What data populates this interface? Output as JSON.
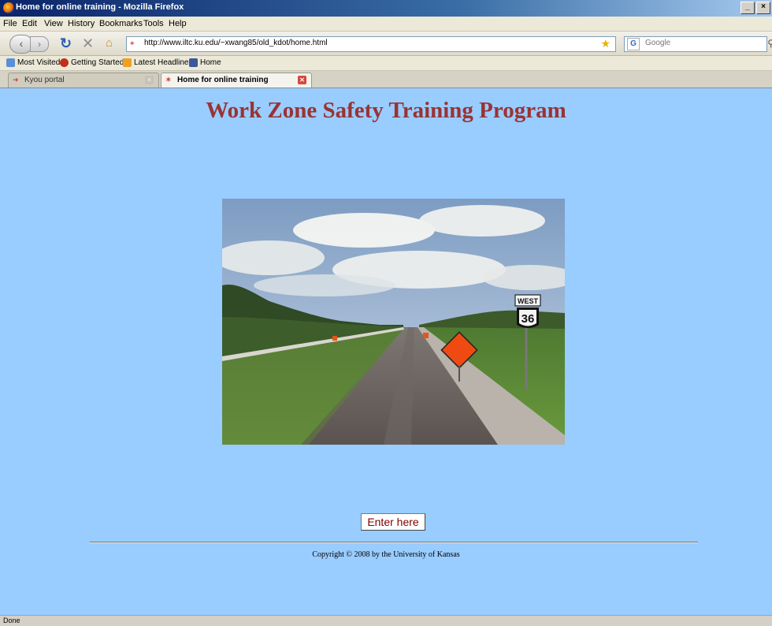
{
  "window": {
    "title": "Home for online training - Mozilla Firefox",
    "buttons": [
      "_",
      "×"
    ]
  },
  "menu": [
    "File",
    "Edit",
    "View",
    "History",
    "Bookmarks",
    "Tools",
    "Help"
  ],
  "nav": {
    "url": "http://www.iltc.ku.edu/~xwang85/old_kdot/home.html",
    "search_placeholder": "Google",
    "search_engine": "G"
  },
  "bookmarks": [
    "Most Visited",
    "Getting Started",
    "Latest Headlines",
    "Home"
  ],
  "tabs": [
    {
      "label": "Kyou portal",
      "active": false
    },
    {
      "label": "Home for online training",
      "active": true
    }
  ],
  "page": {
    "title": "Work Zone Safety Training Program",
    "sign_top": "WEST",
    "sign_number": "36",
    "enter_label": "Enter here",
    "copyright": "Copyright © 2008 by the University of Kansas",
    "bg_color": "#99ccff",
    "title_color": "#993333"
  },
  "status": "Done"
}
